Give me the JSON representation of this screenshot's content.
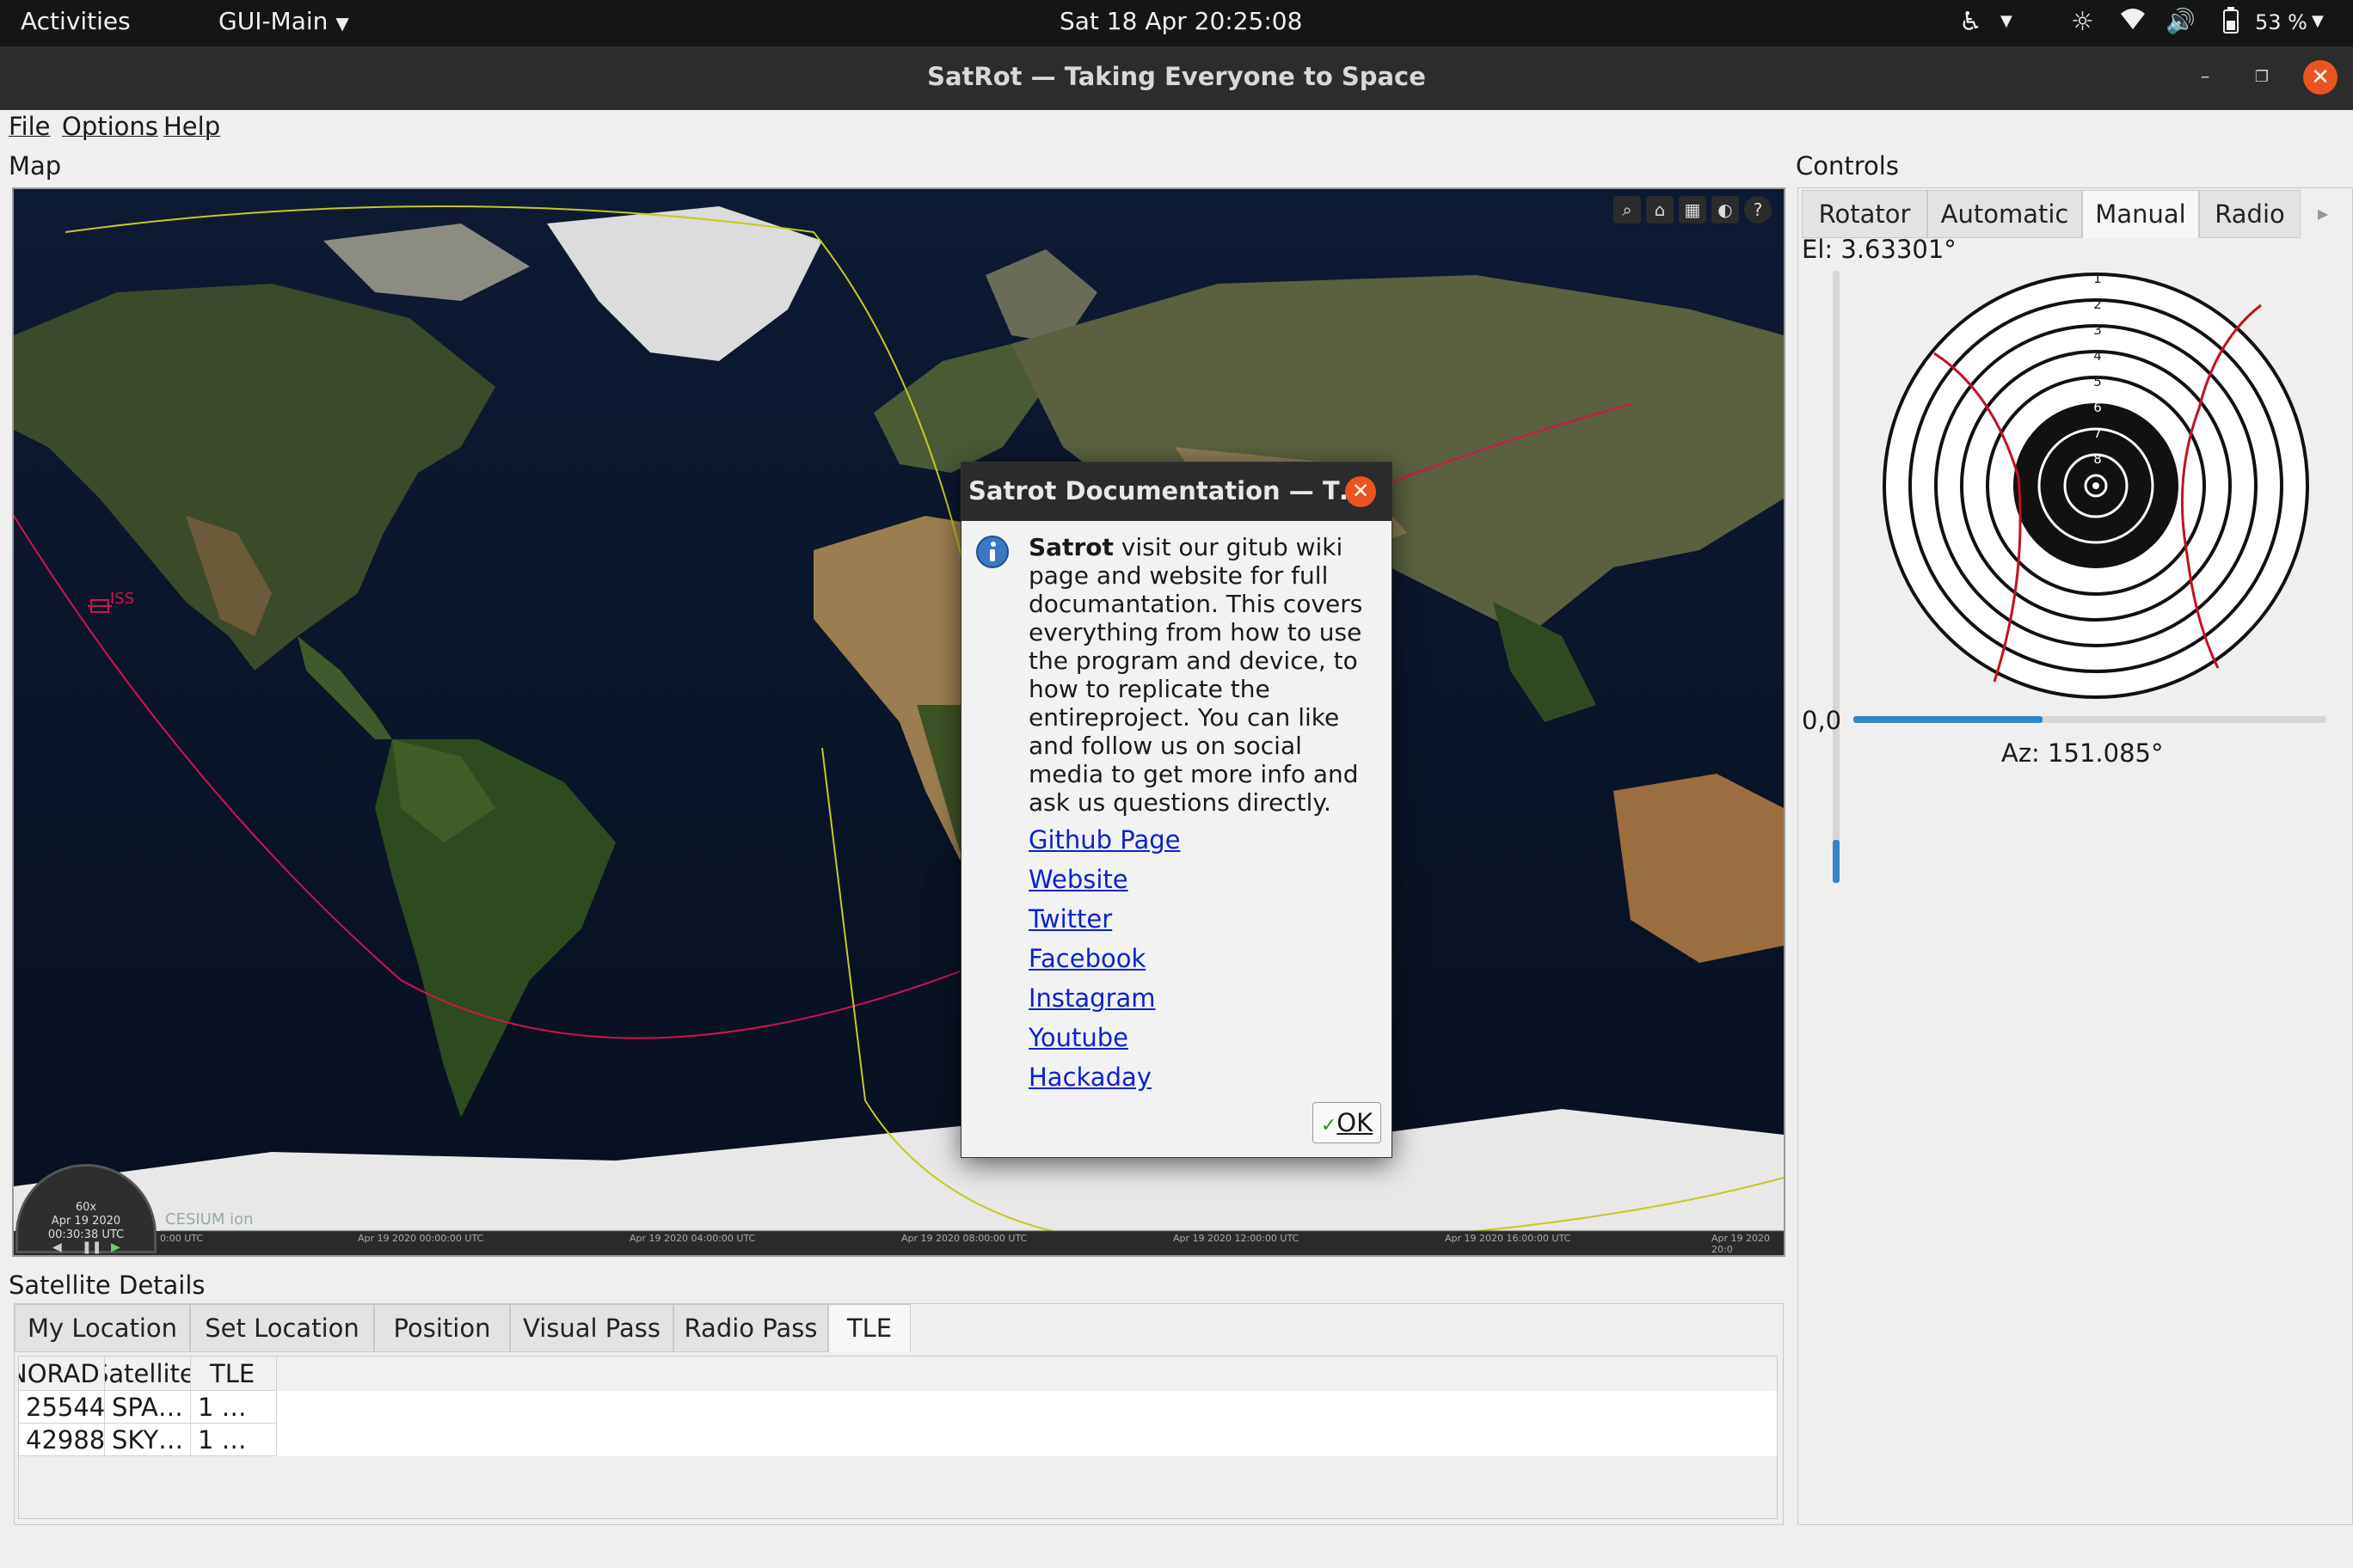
{
  "topbar": {
    "activities": "Activities",
    "app_menu": "GUI-Main",
    "clock": "Sat 18 Apr  20:25:08",
    "battery": "53 %"
  },
  "window": {
    "title": "SatRot —  Taking Everyone to Space"
  },
  "menu": {
    "file": "File",
    "options": "Options",
    "help": "Help"
  },
  "map_section": {
    "label": "Map",
    "satellite_label": "ISS",
    "clock_speed": "60x",
    "clock_date": "Apr 19 2020",
    "clock_time": "00:30:38 UTC",
    "timeline_ticks": [
      "0:00 UTC",
      "Apr 19 2020 00:00:00 UTC",
      "Apr 19 2020 04:00:00 UTC",
      "Apr 19 2020 08:00:00 UTC",
      "Apr 19 2020 12:00:00 UTC",
      "Apr 19 2020 16:00:00 UTC",
      "Apr 19 2020 20:0"
    ],
    "credit": "CESIUM ion"
  },
  "controls": {
    "label": "Controls",
    "tabs": [
      "Rotator",
      "Automatic",
      "Manual",
      "Radio"
    ],
    "active_tab": "Manual",
    "elevation": "El: 3.63301°",
    "azimuth": "Az: 151.085°",
    "origin": "0,0",
    "elevation_slider_fraction": 0.07,
    "azimuth_slider_fraction": 0.4,
    "target_rings": [
      "1",
      "2",
      "3",
      "4",
      "5",
      "6",
      "7",
      "8"
    ]
  },
  "satellite_details": {
    "label": "Satellite Details",
    "tabs": [
      "My Location",
      "Set Location",
      "Position",
      "Visual Pass",
      "Radio Pass",
      "TLE"
    ],
    "active_tab": "TLE",
    "columns": [
      "NORAD ID",
      "Satellite",
      "TLE"
    ],
    "rows": [
      [
        "25544",
        "SPA…",
        "1 …"
      ],
      [
        "42988",
        "SKY…",
        "1 …"
      ]
    ]
  },
  "dialog": {
    "title": "Satrot Documentation —  T…",
    "bold_word": "Satrot",
    "body": " visit our gitub wiki page and website for full documantation. This covers everything from how to use the program and device, to how to replicate the entireproject. You can like and follow us on social media to get more info and ask us questions directly.",
    "links": [
      "Github Page",
      "Website",
      "Twitter",
      "Facebook",
      "Instagram",
      "Youtube",
      "Hackaday"
    ],
    "ok_label": "OK"
  },
  "colors": {
    "accent": "#e95420",
    "link": "#0b24c9",
    "slider": "#3584c4",
    "orbit_red": "#d0144c",
    "orbit_yellow": "#c8c821"
  }
}
